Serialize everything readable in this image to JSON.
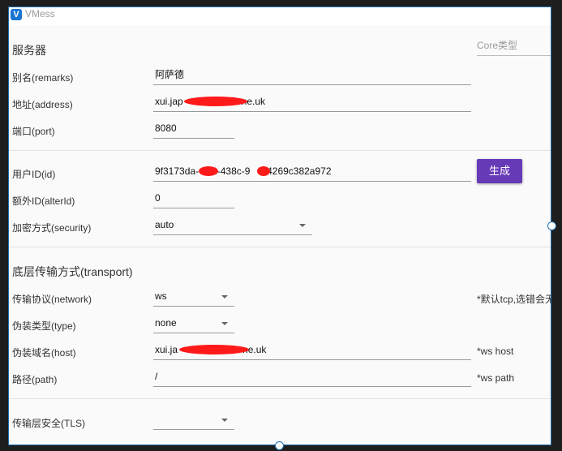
{
  "window": {
    "title": "VMess",
    "icon": "v-logo-icon"
  },
  "server": {
    "section_title": "服务器",
    "core_type_placeholder": "Core类型",
    "remarks": {
      "label": "别名(remarks)",
      "value": "阿萨德"
    },
    "address": {
      "label": "地址(address)",
      "value_prefix": "xui.jap",
      "value_suffix": "ne.uk"
    },
    "port": {
      "label": "端口(port)",
      "value": "8080"
    }
  },
  "user": {
    "id": {
      "label": "用户ID(id)",
      "value_part1": "9f3173da-",
      "value_part2": "2-438c-9",
      "value_part3": "b-4269c382a972"
    },
    "generate_label": "生成",
    "alter_id": {
      "label": "额外ID(alterId)",
      "value": "0"
    },
    "security": {
      "label": "加密方式(security)",
      "value": "auto"
    }
  },
  "transport": {
    "section_title": "底层传输方式(transport)",
    "network": {
      "label": "传输协议(network)",
      "value": "ws",
      "note": "*默认tcp,选错会无"
    },
    "type": {
      "label": "伪装类型(type)",
      "value": "none"
    },
    "host": {
      "label": "伪装域名(host)",
      "value_prefix": "xui.ja",
      "value_suffix": "ne.uk",
      "note": "*ws host"
    },
    "path": {
      "label": "路径(path)",
      "value": "/",
      "note": "*ws path"
    }
  },
  "tls": {
    "label": "传输层安全(TLS)",
    "value": ""
  },
  "colors": {
    "accent": "#673ab7",
    "border": "#1f6fb0",
    "redaction": "#ff1a1a"
  }
}
